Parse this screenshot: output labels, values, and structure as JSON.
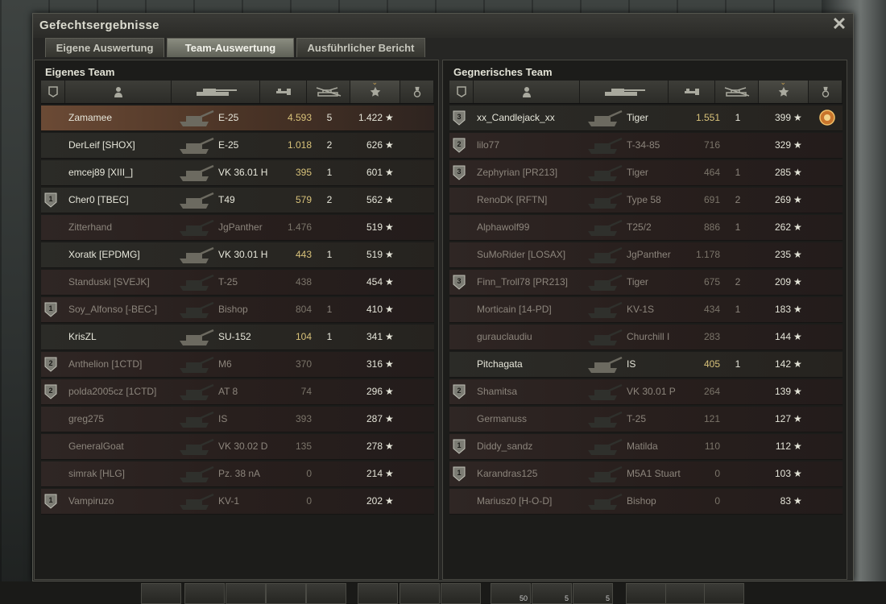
{
  "window": {
    "title": "Gefechtsergebnisse",
    "close_glyph": "✕"
  },
  "tabs": [
    {
      "label": "Eigene Auswertung",
      "active": false
    },
    {
      "label": "Team-Auswertung",
      "active": true
    },
    {
      "label": "Ausführlicher Bericht",
      "active": false
    }
  ],
  "columns": [
    "badge-icon",
    "player-icon",
    "tank-icon",
    "damage-icon",
    "kills-icon",
    "xp-star-icon",
    "medal-icon"
  ],
  "sorted_column": "xp-star-icon",
  "colors": {
    "damage_alive": "#d8c27a",
    "self_row": "#6b4a35"
  },
  "own_team": {
    "title": "Eigenes Team",
    "rows": [
      {
        "badge": "",
        "player": "Zamamee",
        "tank": "E-25",
        "damage": "4.593",
        "kills": "5",
        "xp": "1.422",
        "alive": true,
        "self": true,
        "medal": ""
      },
      {
        "badge": "",
        "player": "DerLeif [SHOX]",
        "tank": "E-25",
        "damage": "1.018",
        "kills": "2",
        "xp": "626",
        "alive": true,
        "self": false,
        "medal": ""
      },
      {
        "badge": "",
        "player": "emcej89 [XIII_]",
        "tank": "VK 36.01 H",
        "damage": "395",
        "kills": "1",
        "xp": "601",
        "alive": true,
        "self": false,
        "medal": ""
      },
      {
        "badge": "1",
        "player": "Cher0 [TBEC]",
        "tank": "T49",
        "damage": "579",
        "kills": "2",
        "xp": "562",
        "alive": true,
        "self": false,
        "medal": ""
      },
      {
        "badge": "",
        "player": "Zitterhand",
        "tank": "JgPanther",
        "damage": "1.476",
        "kills": "",
        "xp": "519",
        "alive": false,
        "self": false,
        "medal": ""
      },
      {
        "badge": "",
        "player": "Xoratk [EPDMG]",
        "tank": "VK 30.01 H",
        "damage": "443",
        "kills": "1",
        "xp": "519",
        "alive": true,
        "self": false,
        "medal": ""
      },
      {
        "badge": "",
        "player": "Standuski [SVEJK]",
        "tank": "T-25",
        "damage": "438",
        "kills": "",
        "xp": "454",
        "alive": false,
        "self": false,
        "medal": ""
      },
      {
        "badge": "1",
        "player": "Soy_Alfonso [-BEC-]",
        "tank": "Bishop",
        "damage": "804",
        "kills": "1",
        "xp": "410",
        "alive": false,
        "self": false,
        "medal": ""
      },
      {
        "badge": "",
        "player": "KrisZL",
        "tank": "SU-152",
        "damage": "104",
        "kills": "1",
        "xp": "341",
        "alive": true,
        "self": false,
        "medal": ""
      },
      {
        "badge": "2",
        "player": "Anthelion [1CTD]",
        "tank": "M6",
        "damage": "370",
        "kills": "",
        "xp": "316",
        "alive": false,
        "self": false,
        "medal": ""
      },
      {
        "badge": "2",
        "player": "polda2005cz [1CTD]",
        "tank": "AT 8",
        "damage": "74",
        "kills": "",
        "xp": "296",
        "alive": false,
        "self": false,
        "medal": ""
      },
      {
        "badge": "",
        "player": "greg275",
        "tank": "IS",
        "damage": "393",
        "kills": "",
        "xp": "287",
        "alive": false,
        "self": false,
        "medal": ""
      },
      {
        "badge": "",
        "player": "GeneralGoat",
        "tank": "VK 30.02 D",
        "damage": "135",
        "kills": "",
        "xp": "278",
        "alive": false,
        "self": false,
        "medal": ""
      },
      {
        "badge": "",
        "player": "simrak [HLG]",
        "tank": "Pz. 38 nA",
        "damage": "0",
        "kills": "",
        "xp": "214",
        "alive": false,
        "self": false,
        "medal": ""
      },
      {
        "badge": "1",
        "player": "Vampiruzo",
        "tank": "KV-1",
        "damage": "0",
        "kills": "",
        "xp": "202",
        "alive": false,
        "self": false,
        "medal": ""
      }
    ]
  },
  "enemy_team": {
    "title": "Gegnerisches Team",
    "rows": [
      {
        "badge": "3",
        "player": "xx_Candlejack_xx",
        "tank": "Tiger",
        "damage": "1.551",
        "kills": "1",
        "xp": "399",
        "alive": true,
        "self": false,
        "medal": "medal-icon"
      },
      {
        "badge": "2",
        "player": "lilo77",
        "tank": "T-34-85",
        "damage": "716",
        "kills": "",
        "xp": "329",
        "alive": false,
        "self": false,
        "medal": ""
      },
      {
        "badge": "3",
        "player": "Zephyrian [PR213]",
        "tank": "Tiger",
        "damage": "464",
        "kills": "1",
        "xp": "285",
        "alive": false,
        "self": false,
        "medal": ""
      },
      {
        "badge": "",
        "player": "RenoDK [RFTN]",
        "tank": "Type 58",
        "damage": "691",
        "kills": "2",
        "xp": "269",
        "alive": false,
        "self": false,
        "medal": ""
      },
      {
        "badge": "",
        "player": "Alphawolf99",
        "tank": "T25/2",
        "damage": "886",
        "kills": "1",
        "xp": "262",
        "alive": false,
        "self": false,
        "medal": ""
      },
      {
        "badge": "",
        "player": "SuMoRider [LOSAX]",
        "tank": "JgPanther",
        "damage": "1.178",
        "kills": "",
        "xp": "235",
        "alive": false,
        "self": false,
        "medal": ""
      },
      {
        "badge": "3",
        "player": "Finn_Troll78 [PR213]",
        "tank": "Tiger",
        "damage": "675",
        "kills": "2",
        "xp": "209",
        "alive": false,
        "self": false,
        "medal": ""
      },
      {
        "badge": "",
        "player": "Morticain [14-PD]",
        "tank": "KV-1S",
        "damage": "434",
        "kills": "1",
        "xp": "183",
        "alive": false,
        "self": false,
        "medal": ""
      },
      {
        "badge": "",
        "player": "gurauclaudiu",
        "tank": "Churchill I",
        "damage": "283",
        "kills": "",
        "xp": "144",
        "alive": false,
        "self": false,
        "medal": ""
      },
      {
        "badge": "",
        "player": "Pitchagata",
        "tank": "IS",
        "damage": "405",
        "kills": "1",
        "xp": "142",
        "alive": true,
        "self": false,
        "medal": ""
      },
      {
        "badge": "2",
        "player": "Shamitsa",
        "tank": "VK 30.01 P",
        "damage": "264",
        "kills": "",
        "xp": "139",
        "alive": false,
        "self": false,
        "medal": ""
      },
      {
        "badge": "",
        "player": "Germanuss",
        "tank": "T-25",
        "damage": "121",
        "kills": "",
        "xp": "127",
        "alive": false,
        "self": false,
        "medal": ""
      },
      {
        "badge": "1",
        "player": "Diddy_sandz",
        "tank": "Matilda",
        "damage": "110",
        "kills": "",
        "xp": "112",
        "alive": false,
        "self": false,
        "medal": ""
      },
      {
        "badge": "1",
        "player": "Karandras125",
        "tank": "M5A1 Stuart",
        "damage": "0",
        "kills": "",
        "xp": "103",
        "alive": false,
        "self": false,
        "medal": ""
      },
      {
        "badge": "",
        "player": "Mariusz0 [H-O-D]",
        "tank": "Bishop",
        "damage": "0",
        "kills": "",
        "xp": "83",
        "alive": false,
        "self": false,
        "medal": ""
      }
    ]
  },
  "star_glyph": "★",
  "bottom_bar": {
    "slots": [
      {
        "count": ""
      },
      {
        "count": ""
      },
      {
        "count": ""
      },
      {
        "count": ""
      },
      {
        "count": ""
      },
      {
        "count": ""
      },
      {
        "count": ""
      },
      {
        "count": ""
      },
      {
        "count": "50"
      },
      {
        "count": "5"
      },
      {
        "count": "5"
      },
      {
        "count": ""
      },
      {
        "count": ""
      },
      {
        "count": ""
      }
    ]
  }
}
